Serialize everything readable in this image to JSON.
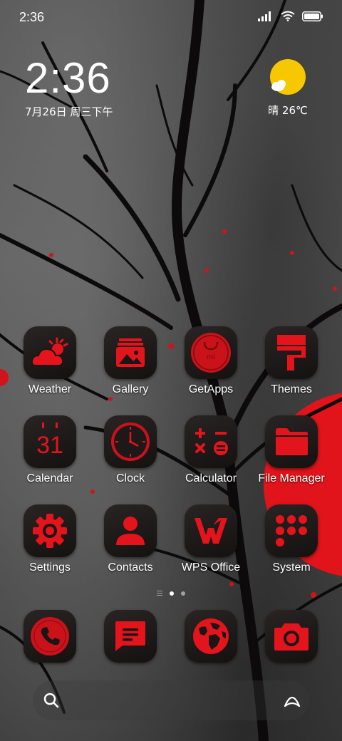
{
  "status_bar": {
    "time": "2:36",
    "icons": [
      "signal-icon",
      "wifi-icon",
      "battery-icon"
    ]
  },
  "clock_widget": {
    "time": "2:36",
    "date": "7月26日 周三下午"
  },
  "weather_widget": {
    "condition": "晴 26℃",
    "icon": "sunny-partly-cloudy-icon"
  },
  "apps": [
    {
      "label": "Weather",
      "icon": "weather-icon"
    },
    {
      "label": "Gallery",
      "icon": "gallery-icon"
    },
    {
      "label": "GetApps",
      "icon": "getapps-icon"
    },
    {
      "label": "Themes",
      "icon": "themes-icon"
    },
    {
      "label": "Calendar",
      "icon": "calendar-icon",
      "badge_text": "31"
    },
    {
      "label": "Clock",
      "icon": "clock-icon"
    },
    {
      "label": "Calculator",
      "icon": "calculator-icon"
    },
    {
      "label": "File Manager",
      "icon": "folder-icon"
    },
    {
      "label": "Settings",
      "icon": "gear-icon"
    },
    {
      "label": "Contacts",
      "icon": "contacts-icon"
    },
    {
      "label": "WPS Office",
      "icon": "wps-icon"
    },
    {
      "label": "System",
      "icon": "system-folder-icon"
    }
  ],
  "dock": [
    {
      "icon": "phone-icon"
    },
    {
      "icon": "messages-icon"
    },
    {
      "icon": "browser-icon"
    },
    {
      "icon": "camera-icon"
    }
  ],
  "page_indicator": {
    "pages": 3,
    "active": 1
  },
  "colors": {
    "accent": "#e3141b",
    "icon_bg": "#1c1818",
    "sun": "#f7c800"
  }
}
